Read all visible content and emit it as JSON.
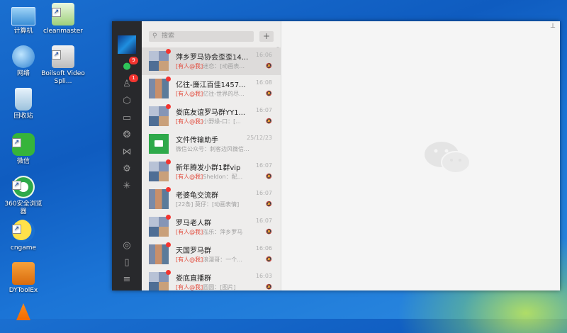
{
  "desktop": {
    "icons": [
      {
        "label": "计算机",
        "icon": "computer-icon"
      },
      {
        "label": "cleanmaster",
        "icon": "cleanmaster-icon"
      },
      {
        "label": "网络",
        "icon": "network-icon"
      },
      {
        "label": "Boilsoft Video Spli...",
        "icon": "boilsoft-icon"
      },
      {
        "label": "回收站",
        "icon": "recycle-bin-icon"
      },
      {
        "label": "微信",
        "icon": "wechat-icon"
      },
      {
        "label": "360安全浏览器",
        "icon": "browser-360-icon"
      },
      {
        "label": "cngame",
        "icon": "cngame-icon"
      },
      {
        "label": "DYToolEx",
        "icon": "dytoolex-icon"
      }
    ],
    "shortcut_arrow": "↗"
  },
  "wechat": {
    "sidebar": {
      "chat_badge": "9",
      "contacts_badge": "1",
      "icons": [
        "chat-icon",
        "contacts-icon",
        "cube-icon",
        "folder-icon",
        "moments-icon",
        "channels-icon",
        "mini-program-icon",
        "search-discover-icon",
        "link-icon",
        "phone-icon",
        "menu-icon"
      ]
    },
    "search": {
      "placeholder": "搜索",
      "add_label": "+"
    },
    "conversations": [
      {
        "name": "萍乡罗马协会歪歪14...",
        "time": "16:06",
        "at": "[有人@我]",
        "preview": "迷恋：[动画表...",
        "muted": true,
        "unread_dot": true
      },
      {
        "name": "亿往-廉江百佳1457...",
        "time": "16:08",
        "at": "[有人@我]",
        "preview": "亿往-世界的尽...",
        "muted": true,
        "unread_dot": true
      },
      {
        "name": "娄底友谊罗马群YY1...",
        "time": "16:07",
        "at": "[有人@我]",
        "preview": "小野缘-口：[...",
        "muted": true,
        "unread_dot": true
      },
      {
        "name": "文件传输助手",
        "time": "25/12/23",
        "at": "",
        "preview": "微信公众号：刺客边风微信...",
        "muted": false,
        "unread_dot": false
      },
      {
        "name": "新年腾发小群1群vip",
        "time": "16:07",
        "at": "[有人@我]",
        "preview": "Sheldon：配...",
        "muted": true,
        "unread_dot": true
      },
      {
        "name": "老婆龟交流群",
        "time": "16:07",
        "at": "",
        "preview": "[22条] 莫仔：[动画表情]",
        "muted": true,
        "unread_dot": true
      },
      {
        "name": "罗马老人群",
        "time": "16:07",
        "at": "[有人@我]",
        "preview": "泓乐：萍乡罗马",
        "muted": true,
        "unread_dot": true
      },
      {
        "name": "天国罗马群",
        "time": "16:06",
        "at": "[有人@我]",
        "preview": "浪漫哥：一个...",
        "muted": true,
        "unread_dot": true
      },
      {
        "name": "娄底直播群",
        "time": "16:03",
        "at": "[有人@我]",
        "preview": "圆圆：[图片]",
        "muted": true,
        "unread_dot": true
      }
    ],
    "mute_glyph": "🔕",
    "pin_glyph": "⊥"
  }
}
